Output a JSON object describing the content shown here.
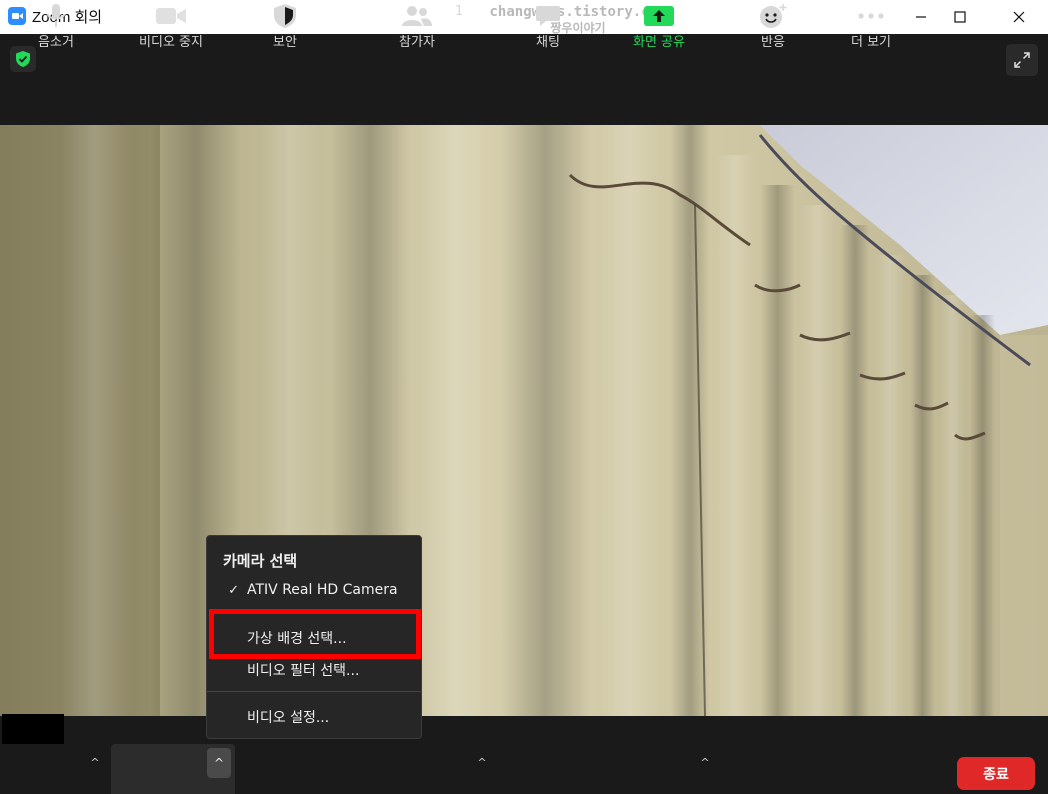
{
  "window": {
    "title": "Zoom 회의",
    "watermark_line1": "changwoos.tistory.com",
    "watermark_line2": "짱우이야기"
  },
  "menu": {
    "header": "카메라 선택",
    "items": [
      {
        "label": "ATIV Real HD Camera",
        "checked": true
      },
      {
        "label": "가상 배경 선택..."
      },
      {
        "label": "비디오 필터 선택..."
      },
      {
        "label": "비디오 설정..."
      }
    ]
  },
  "toolbar": {
    "audio_label": "음소거",
    "video_label": "비디오 중지",
    "security_label": "보안",
    "participants_label": "참가자",
    "participants_count": "1",
    "chat_label": "채팅",
    "share_label": "화면 공유",
    "reactions_label": "반응",
    "more_label": "더 보기",
    "end_label": "종료"
  },
  "colors": {
    "accent_green": "#23d959",
    "end_red": "#e02828",
    "highlight_red": "#ff0000"
  }
}
